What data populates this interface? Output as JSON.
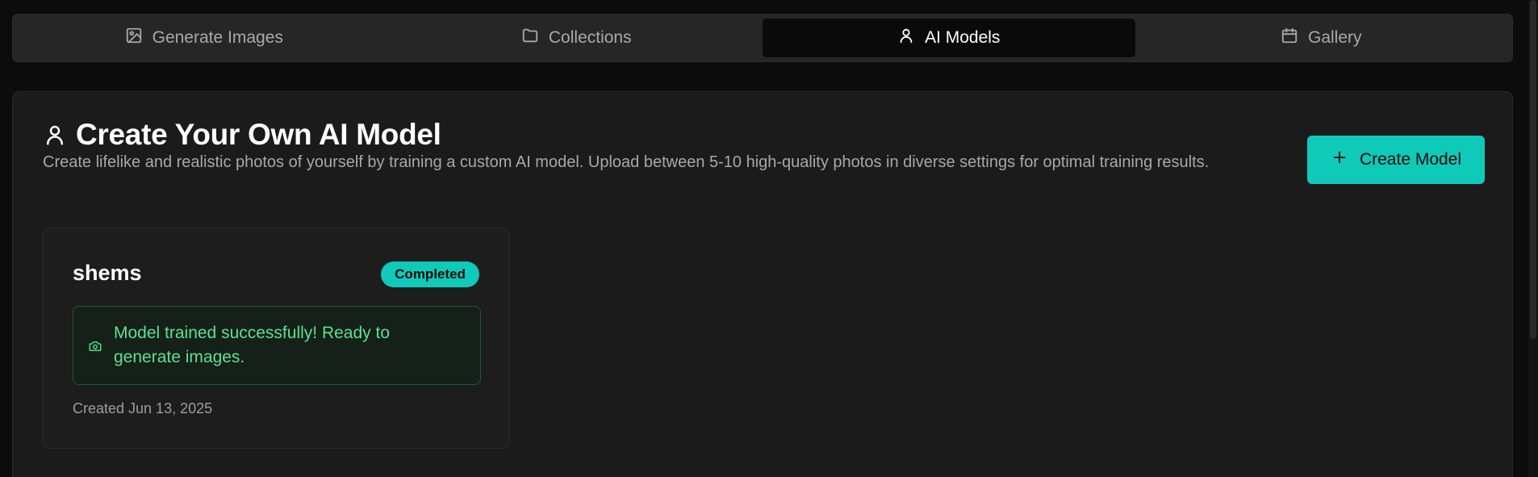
{
  "tabs": [
    {
      "label": "Generate Images",
      "icon": "image-icon",
      "active": false
    },
    {
      "label": "Collections",
      "icon": "folder-icon",
      "active": false
    },
    {
      "label": "AI Models",
      "icon": "user-icon",
      "active": true
    },
    {
      "label": "Gallery",
      "icon": "calendar-icon",
      "active": false
    }
  ],
  "header": {
    "title": "Create Your Own AI Model",
    "description": "Create lifelike and realistic photos of yourself by training a custom AI model. Upload between 5-10 high-quality photos in diverse settings for optimal training results.",
    "create_button_label": "Create Model"
  },
  "models": [
    {
      "name": "shems",
      "status": "Completed",
      "message": "Model trained successfully! Ready to generate images.",
      "created": "Created Jun 13, 2025"
    }
  ],
  "colors": {
    "accent": "#0fcab9",
    "success_text": "#5ee090",
    "background": "#0c0c0c",
    "panel": "#1b1b1b"
  }
}
